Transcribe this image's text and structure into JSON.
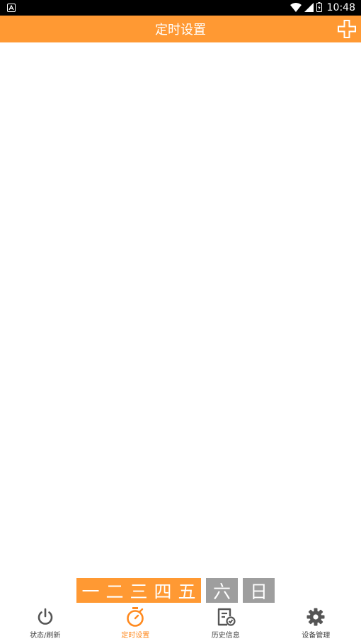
{
  "status_bar": {
    "time": "10:48"
  },
  "app_bar": {
    "title": "定时设置"
  },
  "day_selector": {
    "weekdays": [
      "一",
      "二",
      "三",
      "四",
      "五"
    ],
    "weekend": [
      "六",
      "日"
    ],
    "weekday_color": "#FF9933",
    "weekend_color": "#9E9E9E"
  },
  "bottom_nav": {
    "items": [
      {
        "label": "状态/刷新",
        "icon": "power-icon"
      },
      {
        "label": "定时设置",
        "icon": "stopwatch-icon",
        "active": true
      },
      {
        "label": "历史信息",
        "icon": "history-document-icon"
      },
      {
        "label": "设备管理",
        "icon": "gear-icon"
      }
    ],
    "active_color": "#FF8A1F",
    "inactive_color": "#444444"
  },
  "colors": {
    "brand": "#FF9933"
  }
}
